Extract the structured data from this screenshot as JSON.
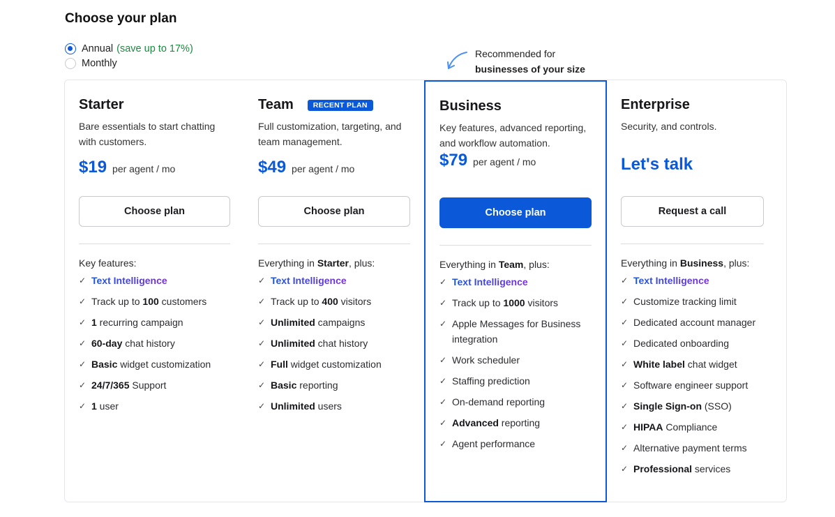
{
  "heading": "Choose your plan",
  "billing": {
    "annual_label": "Annual",
    "annual_save": "(save up to 17%)",
    "monthly_label": "Monthly",
    "selected": "annual"
  },
  "recommendation": {
    "line1": "Recommended for",
    "line2": "businesses of your size"
  },
  "plans": [
    {
      "name": "Starter",
      "description": "Bare essentials to start chatting with customers.",
      "price": "$19",
      "per": "per agent / mo",
      "button": "Choose plan",
      "features_head": "Key features:",
      "features": [
        {
          "pre": "",
          "bold": "",
          "post": "",
          "ti": "Text Intelligence"
        },
        {
          "pre": "Track up to ",
          "bold": "100",
          "post": " customers"
        },
        {
          "pre": "",
          "bold": "1",
          "post": " recurring campaign"
        },
        {
          "pre": "",
          "bold": "60-day",
          "post": " chat history"
        },
        {
          "pre": "",
          "bold": "Basic",
          "post": " widget customization"
        },
        {
          "pre": "",
          "bold": "24/7/365",
          "post": " Support"
        },
        {
          "pre": "",
          "bold": "1",
          "post": " user"
        }
      ]
    },
    {
      "name": "Team",
      "badge": "RECENT PLAN",
      "description": "Full customization, targeting, and team management.",
      "price": "$49",
      "per": "per agent / mo",
      "button": "Choose plan",
      "features_head_pre": "Everything in ",
      "features_head_bold": "Starter",
      "features_head_post": ", plus:",
      "features": [
        {
          "pre": "",
          "bold": "",
          "post": "",
          "ti": "Text Intelligence"
        },
        {
          "pre": "Track up to ",
          "bold": "400",
          "post": " visitors"
        },
        {
          "pre": "",
          "bold": "Unlimited",
          "post": " campaigns"
        },
        {
          "pre": "",
          "bold": "Unlimited",
          "post": " chat history"
        },
        {
          "pre": "",
          "bold": "Full",
          "post": " widget customization"
        },
        {
          "pre": "",
          "bold": "Basic",
          "post": " reporting"
        },
        {
          "pre": "",
          "bold": "Unlimited",
          "post": " users"
        }
      ]
    },
    {
      "name": "Business",
      "description": "Key features, advanced reporting, and workflow automation.",
      "price": "$79",
      "per": "per agent / mo",
      "button": "Choose plan",
      "features_head_pre": "Everything in ",
      "features_head_bold": "Team",
      "features_head_post": ", plus:",
      "features": [
        {
          "pre": "",
          "bold": "",
          "post": "",
          "ti": "Text Intelligence"
        },
        {
          "pre": "Track up to ",
          "bold": "1000",
          "post": " visitors"
        },
        {
          "pre": "Apple Messages for Business integration",
          "bold": "",
          "post": ""
        },
        {
          "pre": "Work scheduler",
          "bold": "",
          "post": ""
        },
        {
          "pre": "Staffing prediction",
          "bold": "",
          "post": ""
        },
        {
          "pre": "On-demand reporting",
          "bold": "",
          "post": ""
        },
        {
          "pre": "",
          "bold": "Advanced",
          "post": " reporting"
        },
        {
          "pre": "Agent performance",
          "bold": "",
          "post": ""
        }
      ]
    },
    {
      "name": "Enterprise",
      "description": "Security, and controls.",
      "price_text": "Let's talk",
      "button": "Request a call",
      "features_head_pre": "Everything in ",
      "features_head_bold": "Business",
      "features_head_post": ", plus:",
      "features": [
        {
          "pre": "",
          "bold": "",
          "post": "",
          "ti": "Text Intelligence"
        },
        {
          "pre": "Customize tracking limit",
          "bold": "",
          "post": ""
        },
        {
          "pre": "Dedicated account manager",
          "bold": "",
          "post": ""
        },
        {
          "pre": "Dedicated onboarding",
          "bold": "",
          "post": ""
        },
        {
          "pre": "",
          "bold": "White label",
          "post": " chat widget"
        },
        {
          "pre": "Software engineer support",
          "bold": "",
          "post": ""
        },
        {
          "pre": "",
          "bold": "Single Sign-on",
          "post": " (SSO)"
        },
        {
          "pre": "",
          "bold": "HIPAA",
          "post": " Compliance"
        },
        {
          "pre": "Alternative payment terms",
          "bold": "",
          "post": ""
        },
        {
          "pre": "",
          "bold": "Professional",
          "post": " services"
        }
      ]
    }
  ],
  "colors": {
    "accent": "#0b59d8",
    "save_green": "#1a8a3f",
    "text_intelligence_gradient": [
      "#1a56db",
      "#7b2fd6"
    ]
  },
  "icons": {
    "check": "check-icon",
    "arrow": "curved-arrow-icon"
  }
}
